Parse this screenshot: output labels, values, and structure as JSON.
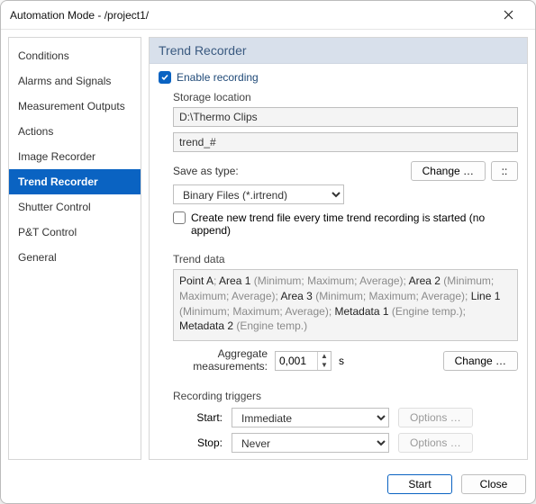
{
  "window": {
    "title": "Automation Mode - /project1/"
  },
  "sidebar": {
    "items": [
      {
        "label": "Conditions"
      },
      {
        "label": "Alarms and Signals"
      },
      {
        "label": "Measurement Outputs"
      },
      {
        "label": "Actions"
      },
      {
        "label": "Image Recorder"
      },
      {
        "label": "Trend Recorder"
      },
      {
        "label": "Shutter Control"
      },
      {
        "label": "P&T Control"
      },
      {
        "label": "General"
      }
    ],
    "active_index": 5
  },
  "panel": {
    "title": "Trend Recorder",
    "enable_label": "Enable recording",
    "enable_checked": true,
    "storage": {
      "legend": "Storage location",
      "folder": "D:\\Thermo Clips",
      "filename_pattern": "trend_#",
      "save_as_label": "Save as type:",
      "save_as_value": "Binary Files (*.irtrend)",
      "change_button": "Change …",
      "square_button": "::",
      "create_new_label": "Create new trend file every time trend recording is started (no append)",
      "create_new_checked": false
    },
    "trend_data": {
      "legend": "Trend data",
      "segments": [
        {
          "text": "Point A",
          "strong": true
        },
        {
          "text": "; "
        },
        {
          "text": "Area 1",
          "strong": true
        },
        {
          "text": " (Minimum; Maximum; Average); "
        },
        {
          "text": "Area 2",
          "strong": true
        },
        {
          "text": " (Minimum; Maximum; Average); "
        },
        {
          "text": "Area 3",
          "strong": true
        },
        {
          "text": " (Minimum; Maximum; Average); "
        },
        {
          "text": "Line 1",
          "strong": true
        },
        {
          "text": " (Minimum; Maximum; Average); "
        },
        {
          "text": "Metadata 1",
          "strong": true
        },
        {
          "text": " (Engine temp.); "
        },
        {
          "text": "Metadata 2",
          "strong": true
        },
        {
          "text": " (Engine temp.)"
        }
      ],
      "aggregate_label": "Aggregate measurements:",
      "aggregate_value": "0,001",
      "aggregate_unit": "s",
      "change_button": "Change …"
    },
    "triggers": {
      "legend": "Recording triggers",
      "start_label": "Start:",
      "start_value": "Immediate",
      "stop_label": "Stop:",
      "stop_value": "Never",
      "options_button": "Options …"
    }
  },
  "footer": {
    "start": "Start",
    "close": "Close"
  }
}
